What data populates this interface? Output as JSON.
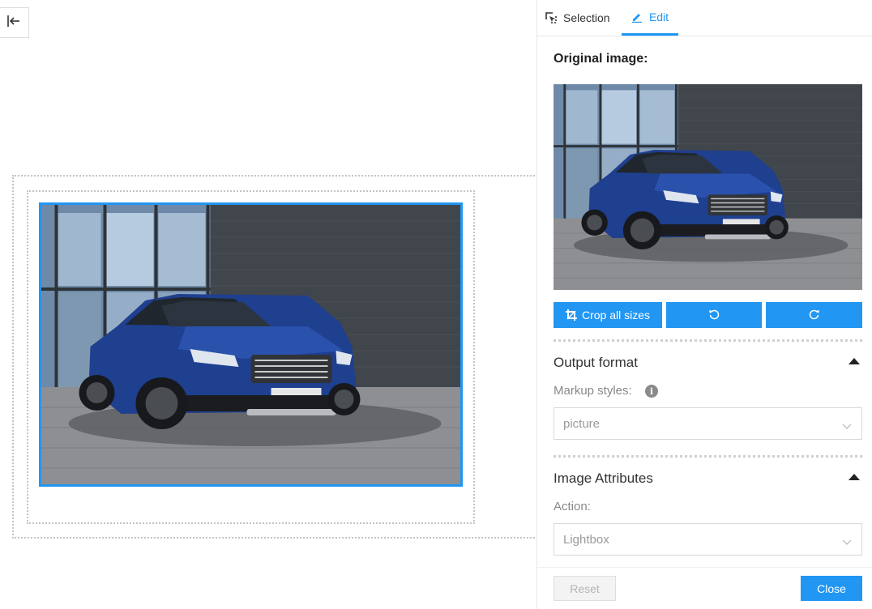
{
  "tabs": {
    "selection_label": "Selection",
    "edit_label": "Edit"
  },
  "panel": {
    "original_image_title": "Original image:",
    "crop_all_label": "Crop all sizes",
    "output_format_title": "Output format",
    "markup_styles_label": "Markup styles:",
    "markup_styles_value": "picture",
    "image_attributes_title": "Image Attributes",
    "action_label": "Action:",
    "action_value": "Lightbox",
    "reset_label": "Reset",
    "close_label": "Close"
  },
  "icons": {
    "collapse": "arrow-left-to-line-icon",
    "selection": "cursor-select-icon",
    "edit": "pencil-icon",
    "crop": "crop-icon",
    "rotate_left": "rotate-left-icon",
    "rotate_right": "rotate-right-icon",
    "info": "info-icon",
    "chevron": "chevron-down-icon"
  },
  "colors": {
    "accent": "#2196f3",
    "car_body": "#1f3f8f"
  }
}
